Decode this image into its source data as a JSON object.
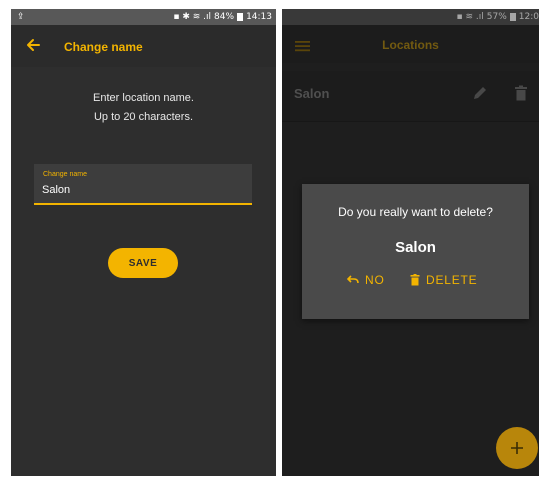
{
  "left": {
    "status": {
      "battery": "84%",
      "time": "14:13"
    },
    "title": "Change name",
    "instructions": [
      "Enter location name.",
      "Up to 20 characters."
    ],
    "field": {
      "label": "Change name",
      "value": "Salon"
    },
    "save_label": "SAVE"
  },
  "right": {
    "status": {
      "battery": "57%",
      "time": "12:0"
    },
    "title": "Locations",
    "list": [
      {
        "name": "Salon"
      }
    ],
    "dialog": {
      "question": "Do you really want to delete?",
      "name": "Salon",
      "no_label": "NO",
      "delete_label": "DELETE"
    },
    "fab_label": "+"
  },
  "colors": {
    "accent": "#f3b400",
    "background": "#2e2e2e",
    "dialog": "#4a4a4a"
  },
  "icons": [
    "upload-icon",
    "back-arrow-icon",
    "menu-icon",
    "edit-pencil-icon",
    "trash-icon",
    "undo-icon",
    "plus-icon"
  ]
}
